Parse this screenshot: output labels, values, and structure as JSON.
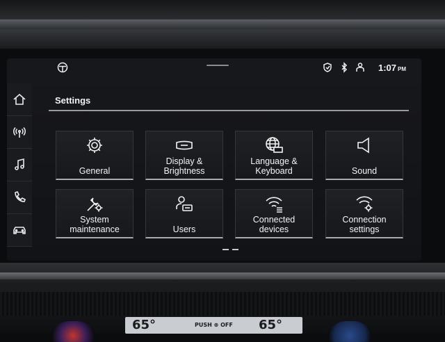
{
  "screen": {
    "title": "Settings",
    "clock": {
      "time": "1:07",
      "ampm": "PM"
    }
  },
  "sidebar": {
    "items": [
      {
        "icon": "home-icon"
      },
      {
        "icon": "radio-antenna-icon"
      },
      {
        "icon": "music-note-icon"
      },
      {
        "icon": "phone-icon"
      },
      {
        "icon": "car-icon"
      }
    ]
  },
  "tiles": [
    {
      "label": "General",
      "icon": "gear-icon"
    },
    {
      "label": "Display &\nBrightness",
      "icon": "display-icon"
    },
    {
      "label": "Language &\nKeyboard",
      "icon": "globe-keyboard-icon"
    },
    {
      "label": "Sound",
      "icon": "speaker-icon"
    },
    {
      "label": "System\nmaintenance",
      "icon": "wrench-gear-icon"
    },
    {
      "label": "Users",
      "icon": "user-card-icon"
    },
    {
      "label": "Connected\ndevices",
      "icon": "wifi-list-icon"
    },
    {
      "label": "Connection\nsettings",
      "icon": "wifi-gear-icon"
    }
  ],
  "hvac": {
    "left_temp": "65°",
    "right_temp": "65°",
    "center": "PUSH ⊗ OFF"
  },
  "colors": {
    "screen_bg": "#141518",
    "text": "#f2f2f2",
    "accent_line": "#a9aaae"
  }
}
